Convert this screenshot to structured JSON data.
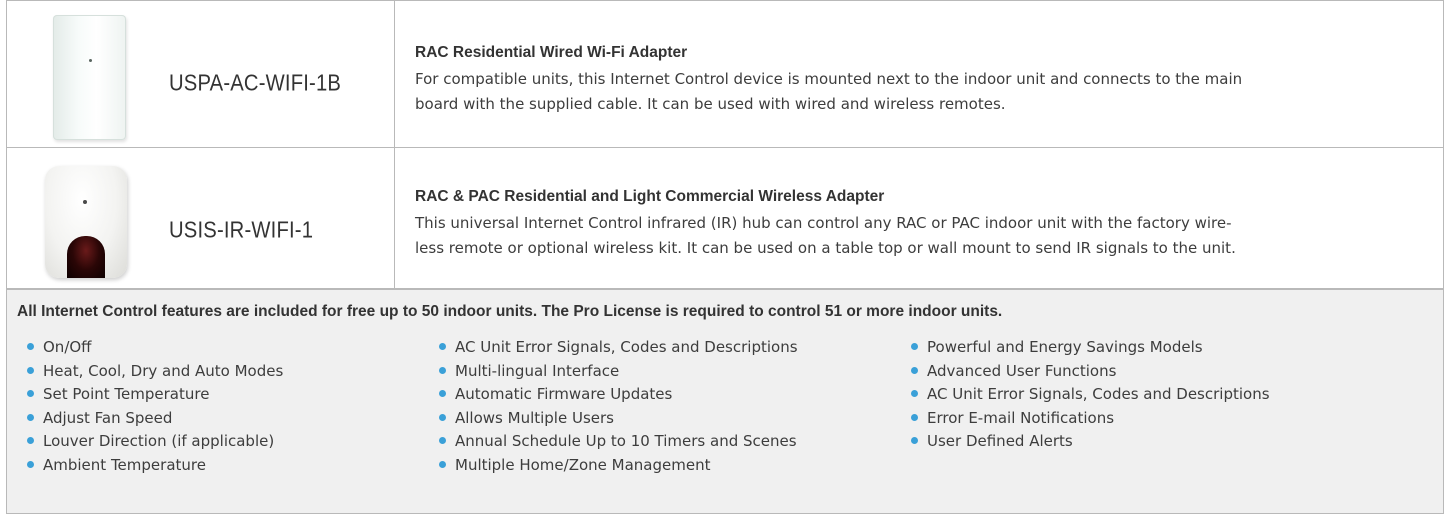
{
  "products": [
    {
      "model": "USPA-AC-WIFI-1B",
      "image_icon": "wired-wifi-adapter-image",
      "title": "RAC Residential Wired Wi-Fi Adapter",
      "description_lines": [
        "For compatible units, this Internet Control device is mounted next to the indoor unit and connects to the main",
        "board with the supplied cable. It can be used with wired and wireless remotes."
      ]
    },
    {
      "model": "USIS-IR-WIFI-1",
      "image_icon": "ir-wireless-adapter-image",
      "title": "RAC & PAC Residential and Light Commercial Wireless Adapter",
      "description_lines": [
        "This universal Internet Control infrared (IR) hub can control any RAC or PAC indoor unit with the factory wire-",
        "less remote or optional wireless kit. It can be used on a table top or wall mount to send IR signals to the unit."
      ]
    }
  ],
  "features": {
    "heading": "All Internet Control features are included for free up to 50 indoor units. The Pro License is required to control 51 or more indoor units.",
    "bullet_color": "#3aa0d8",
    "columns": [
      [
        "On/Off",
        "Heat, Cool, Dry and Auto Modes",
        "Set Point Temperature",
        "Adjust Fan Speed",
        "Louver Direction (if applicable)",
        "Ambient Temperature"
      ],
      [
        "AC Unit Error Signals, Codes and Descriptions",
        "Multi-lingual Interface",
        "Automatic Firmware Updates",
        "Allows Multiple Users",
        "Annual Schedule Up to 10 Timers and Scenes",
        "Multiple Home/Zone Management"
      ],
      [
        "Powerful and Energy Savings Models",
        "Advanced User Functions",
        "AC Unit Error Signals, Codes and Descriptions",
        "Error E-mail Notifications",
        "User Defined Alerts"
      ]
    ]
  }
}
